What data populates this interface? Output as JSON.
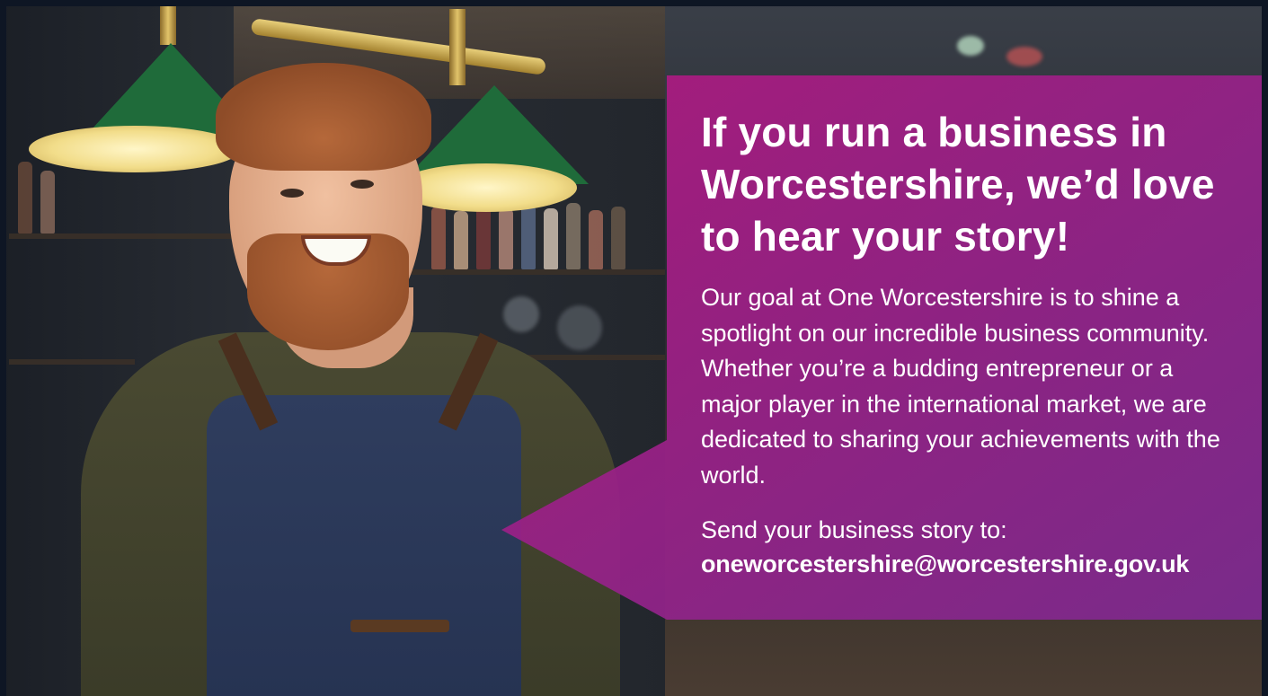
{
  "banner": {
    "headline": "If you run a business in Worcestershire, we’d love to hear your story!",
    "body": "Our goal at One Worcestershire is to shine a spotlight on our incredible business community. Whether you’re a budding entrepreneur or a major player in the international market, we are dedicated to sharing your achievements with the world.",
    "send_label": "Send your business story to:",
    "email": "oneworcestershire@worcestershire.gov.uk",
    "email_href": "mailto:oneworcestershire@worcestershire.gov.uk"
  },
  "colors": {
    "bubble_start": "#b0197f",
    "bubble_end": "#7d2a91",
    "text": "#ffffff",
    "frame": "#0e1624"
  },
  "photo": {
    "subject": "smiling bearded barista in denim apron inside a cafe with green pendant lamps"
  }
}
